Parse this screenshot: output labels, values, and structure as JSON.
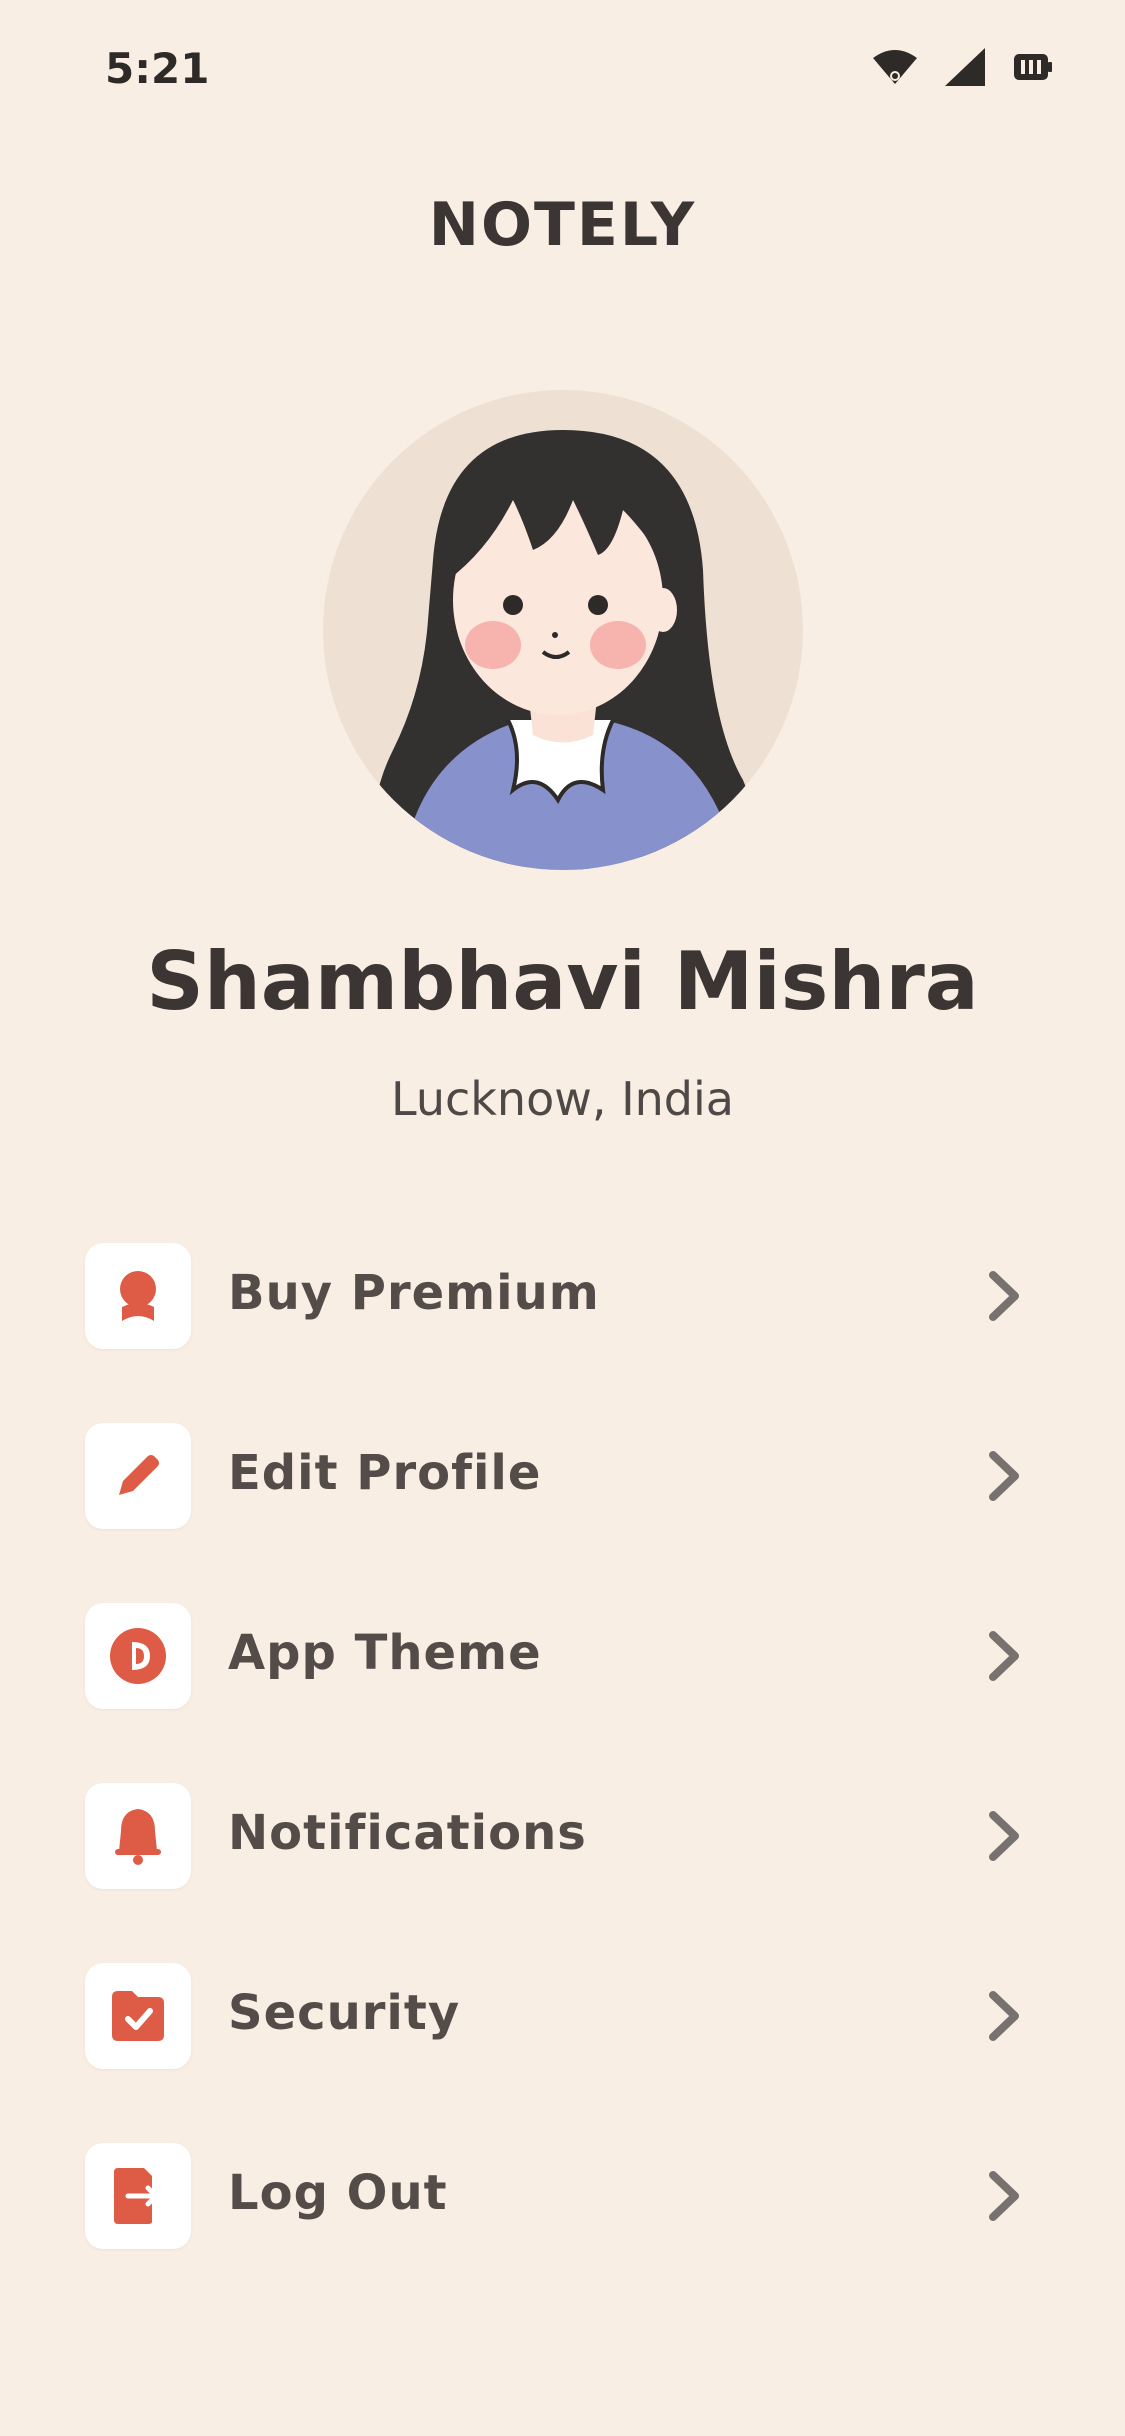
{
  "status_bar": {
    "time": "5:21",
    "icons": [
      "wifi-icon",
      "signal-icon",
      "battery-icon"
    ]
  },
  "app": {
    "title": "NOTELY"
  },
  "profile": {
    "name": "Shambhavi Mishra",
    "location": "Lucknow, India",
    "avatar": "avatar-illustration"
  },
  "menu": {
    "items": [
      {
        "label": "Buy Premium",
        "icon": "premium-badge-icon"
      },
      {
        "label": "Edit Profile",
        "icon": "pencil-icon"
      },
      {
        "label": "App Theme",
        "icon": "theme-icon"
      },
      {
        "label": "Notifications",
        "icon": "bell-icon"
      },
      {
        "label": "Security",
        "icon": "shield-folder-icon"
      },
      {
        "label": "Log Out",
        "icon": "logout-icon"
      }
    ]
  },
  "colors": {
    "background": "#F8EEE4",
    "accent": "#DE5B45",
    "text": "#3B3534"
  }
}
